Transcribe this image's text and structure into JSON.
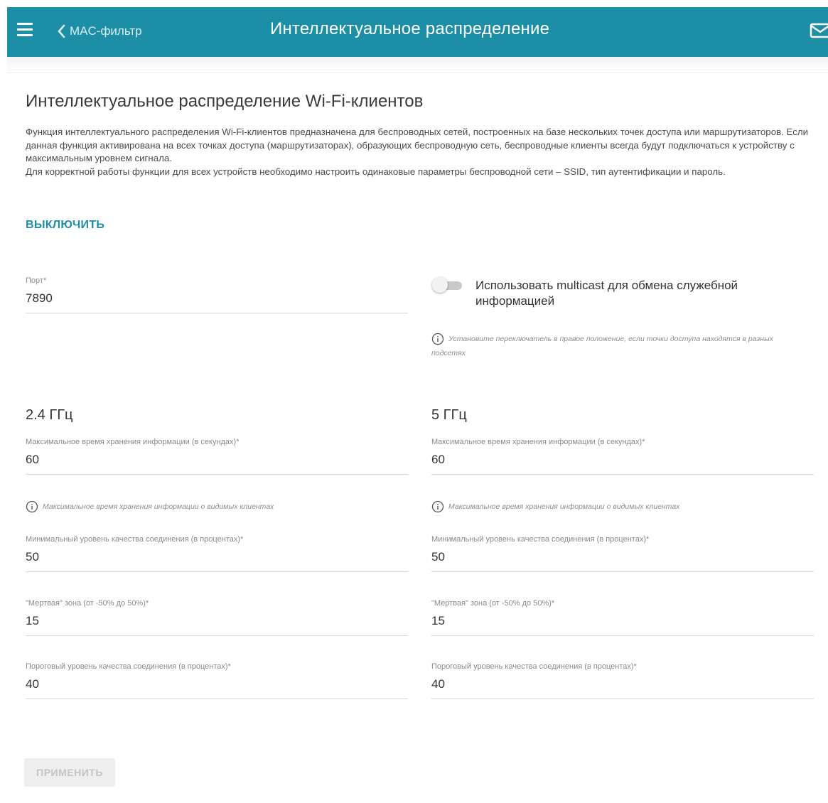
{
  "header": {
    "back_label": "MAC-фильтр",
    "title": "Интеллектуальное распределение"
  },
  "page": {
    "heading": "Интеллектуальное распределение Wi-Fi-клиентов",
    "description_1": "Функция интеллектуального распределения Wi-Fi-клиентов предназначена для беспроводных сетей, построенных на базе нескольких точек доступа или маршрутизаторов. Если данная функция активирована на всех точках доступа (маршрутизаторах), образующих беспроводную сеть, беспроводные клиенты всегда будут подключаться к устройству с максимальным уровнем сигнала.",
    "description_2": "Для корректной работы функции для всех устройств необходимо настроить одинаковые параметры беспроводной сети – SSID, тип аутентификации и пароль.",
    "disable_label": "ВЫКЛЮЧИТЬ"
  },
  "general": {
    "port_label": "Порт*",
    "port_value": "7890",
    "multicast_label": "Использовать multicast для обмена служебной информацией",
    "multicast_enabled": false,
    "multicast_hint": "Установите переключатель в правое положение, если точки доступа находятся в разных подсетях"
  },
  "band_24": {
    "title": "2.4 ГГц",
    "max_time_label": "Максимальное время хранения информации (в секундах)*",
    "max_time_value": "60",
    "max_time_hint": "Максимальное время хранения информации о видимых клиентах",
    "min_quality_label": "Минимальный уровень качества соединения (в процентах)*",
    "min_quality_value": "50",
    "dead_zone_label": "\"Мертвая\" зона (от -50% до 50%)*",
    "dead_zone_value": "15",
    "threshold_label": "Пороговый уровень качества соединения (в процентах)*",
    "threshold_value": "40"
  },
  "band_5": {
    "title": "5 ГГц",
    "max_time_label": "Максимальное время хранения информации (в секундах)*",
    "max_time_value": "60",
    "max_time_hint": "Максимальное время хранения информации о видимых клиентах",
    "min_quality_label": "Минимальный уровень качества соединения (в процентах)*",
    "min_quality_value": "50",
    "dead_zone_label": "\"Мертвая\" зона (от -50% до 50%)*",
    "dead_zone_value": "15",
    "threshold_label": "Пороговый уровень качества соединения (в процентах)*",
    "threshold_value": "40"
  },
  "actions": {
    "apply_label": "ПРИМЕНИТЬ"
  },
  "colors": {
    "header_bg": "#1c8ea6",
    "accent": "#1c8ea6"
  },
  "icons": {
    "menu": "hamburger-icon",
    "back": "chevron-left-icon",
    "mail": "mail-icon",
    "info": "info-icon"
  }
}
